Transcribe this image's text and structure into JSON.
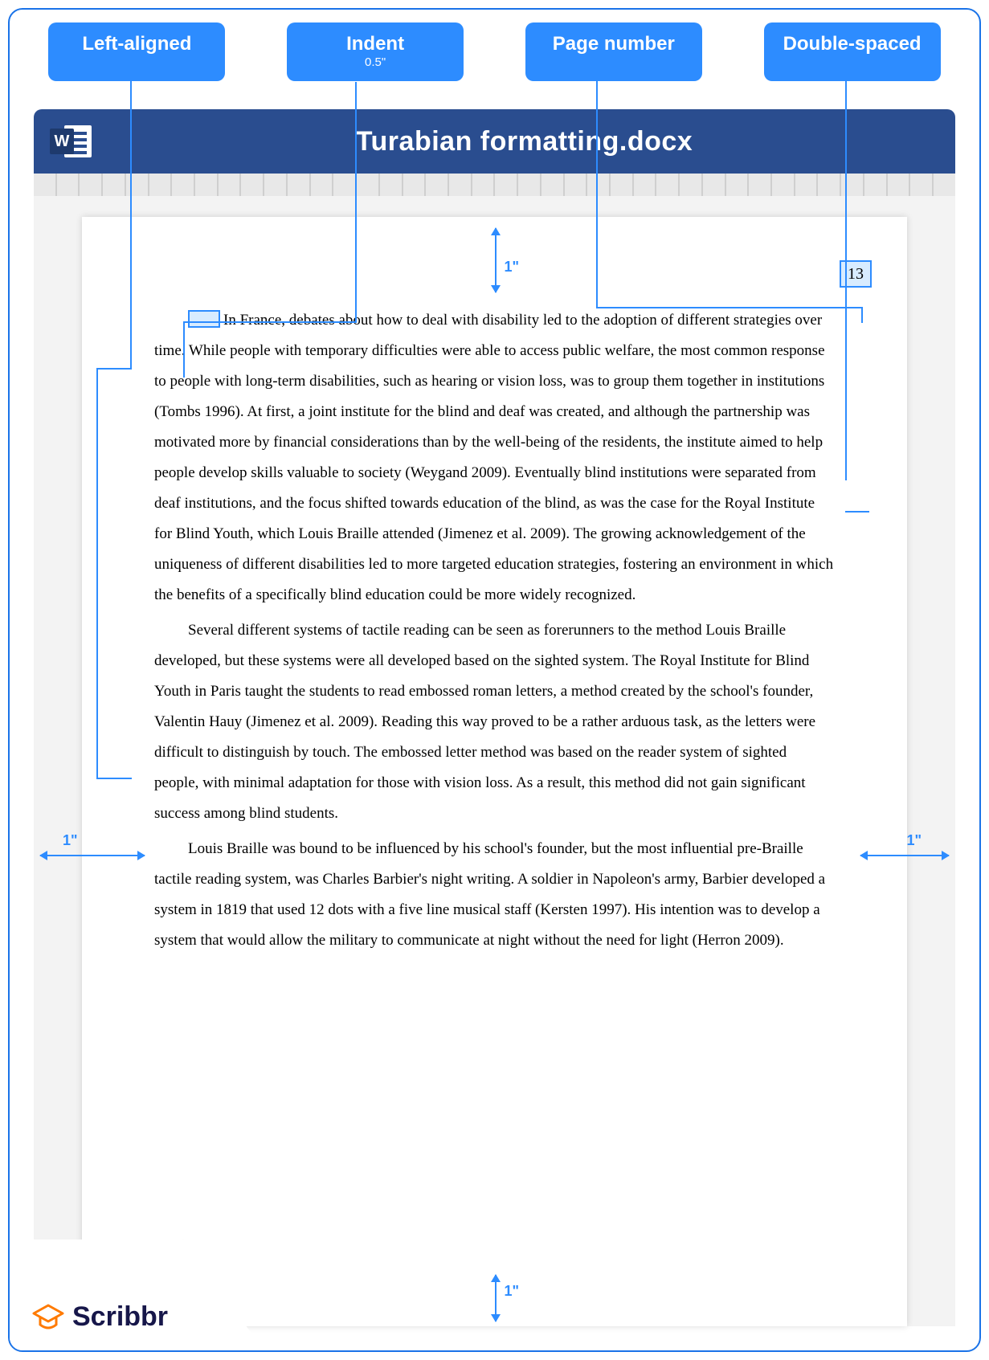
{
  "labels": {
    "left_aligned": "Left-aligned",
    "indent": "Indent",
    "indent_sub": "0.5\"",
    "page_number": "Page number",
    "double_spaced": "Double-spaced"
  },
  "titlebar": {
    "filename": "Turabian formatting.docx",
    "word_letter": "W"
  },
  "page": {
    "page_number": "13",
    "margins": {
      "top": "1\"",
      "bottom": "1\"",
      "left": "1\"",
      "right": "1\""
    },
    "paragraphs": [
      "In France, debates about how to deal with disability led to the adoption of different strategies over time. While people with temporary difficulties were able to access public welfare, the most common response to people with long-term disabilities, such as hearing or vision loss, was to group them together in institutions (Tombs 1996). At first, a joint institute for the blind and deaf was created, and although the partnership was motivated more by financial considerations than by the well-being of the residents, the institute aimed to help people develop skills valuable to society (Weygand 2009). Eventually blind institutions were separated from deaf institutions, and the focus shifted towards education of the blind, as was the case for the Royal Institute for Blind Youth, which Louis Braille attended (Jimenez et al. 2009). The growing acknowledgement of the uniqueness of different disabilities led to more targeted education strategies, fostering an environment in which the benefits of a specifically blind education could be more widely recognized.",
      "Several different systems of tactile reading can be seen as forerunners to the method Louis Braille developed, but these systems were all developed based on the sighted system. The Royal Institute for Blind Youth in Paris taught the students to read embossed roman letters, a method created by the school's founder, Valentin Hauy (Jimenez et al. 2009). Reading this way proved to be a rather arduous task, as the letters were difficult to distinguish by touch. The embossed letter method was based on the reader system of sighted people, with minimal adaptation for those with vision loss. As a result, this method did not gain significant success among blind students.",
      "Louis Braille was bound to be influenced by his school's founder, but the most influential pre-Braille tactile reading system, was Charles Barbier's night writing. A soldier in Napoleon's army, Barbier developed a system in 1819 that used 12 dots with a five line musical staff (Kersten 1997). His intention was to develop a system that would allow the military to communicate at night without the need for light (Herron 2009)."
    ]
  },
  "brand": {
    "name": "Scribbr"
  }
}
